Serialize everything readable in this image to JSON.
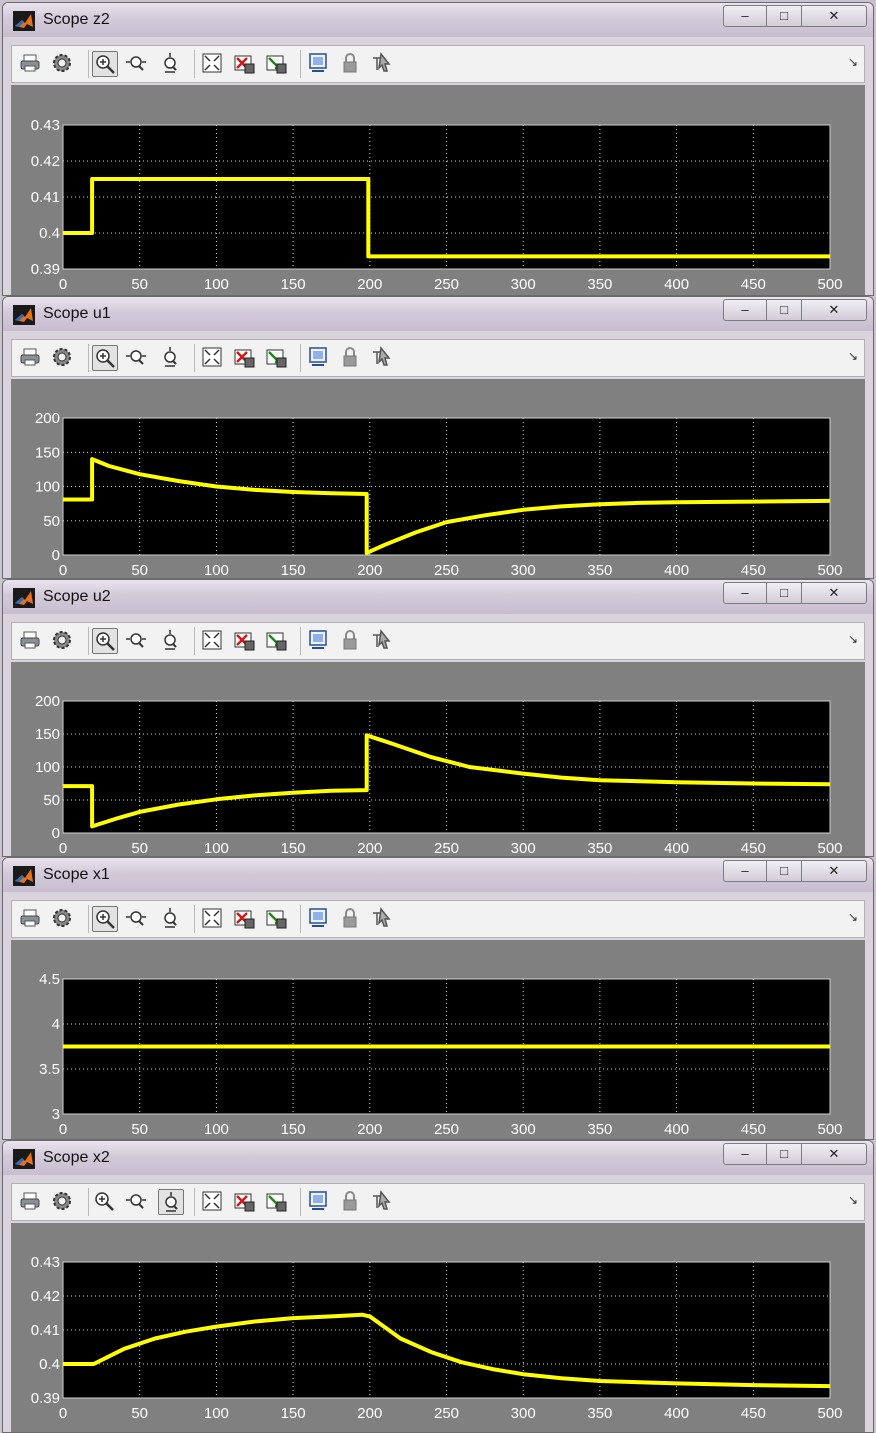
{
  "windows": [
    {
      "title": "Scope z2",
      "chart_data": {
        "type": "line",
        "xlim": [
          0,
          500
        ],
        "ylim": [
          0.39,
          0.43
        ],
        "xticks": [
          "0",
          "50",
          "100",
          "150",
          "200",
          "250",
          "300",
          "350",
          "400",
          "450",
          "500"
        ],
        "yticks": [
          "0.39",
          "0.4",
          "0.41",
          "0.42",
          "0.43"
        ],
        "grid": true,
        "color": "#ffff00",
        "x": [
          0,
          19,
          19,
          199,
          199,
          500
        ],
        "y": [
          0.4,
          0.4,
          0.415,
          0.415,
          0.3935,
          0.3935
        ]
      }
    },
    {
      "title": "Scope u1",
      "chart_data": {
        "type": "line",
        "xlim": [
          0,
          500
        ],
        "ylim": [
          0,
          200
        ],
        "xticks": [
          "0",
          "50",
          "100",
          "150",
          "200",
          "250",
          "300",
          "350",
          "400",
          "450",
          "500"
        ],
        "yticks": [
          "0",
          "50",
          "100",
          "150",
          "200"
        ],
        "grid": true,
        "color": "#ffff00",
        "x": [
          0,
          19,
          19,
          30,
          50,
          75,
          100,
          125,
          150,
          175,
          198,
          198,
          210,
          230,
          250,
          275,
          300,
          325,
          350,
          375,
          400,
          450,
          500
        ],
        "y": [
          81,
          81,
          140,
          130,
          118,
          108,
          100,
          95,
          92,
          90,
          89,
          3,
          15,
          33,
          48,
          58,
          66,
          71,
          74,
          76,
          77,
          78,
          79
        ]
      }
    },
    {
      "title": "Scope u2",
      "chart_data": {
        "type": "line",
        "xlim": [
          0,
          500
        ],
        "ylim": [
          0,
          200
        ],
        "xticks": [
          "0",
          "50",
          "100",
          "150",
          "200",
          "250",
          "300",
          "350",
          "400",
          "450",
          "500"
        ],
        "yticks": [
          "0",
          "50",
          "100",
          "150",
          "200"
        ],
        "grid": true,
        "color": "#ffff00",
        "x": [
          0,
          19,
          19,
          35,
          50,
          75,
          100,
          125,
          150,
          175,
          198,
          198,
          215,
          240,
          265,
          300,
          325,
          350,
          400,
          450,
          500
        ],
        "y": [
          71,
          71,
          10,
          22,
          32,
          43,
          51,
          57,
          61,
          64,
          65,
          148,
          135,
          115,
          100,
          90,
          84,
          80,
          77,
          75,
          74
        ]
      }
    },
    {
      "title": "Scope x1",
      "chart_data": {
        "type": "line",
        "xlim": [
          0,
          500
        ],
        "ylim": [
          3,
          4.5
        ],
        "xticks": [
          "0",
          "50",
          "100",
          "150",
          "200",
          "250",
          "300",
          "350",
          "400",
          "450",
          "500"
        ],
        "yticks": [
          "3",
          "3.5",
          "4",
          "4.5"
        ],
        "grid": true,
        "color": "#ffff00",
        "x": [
          0,
          500
        ],
        "y": [
          3.75,
          3.75
        ]
      }
    },
    {
      "title": "Scope x2",
      "chart_data": {
        "type": "line",
        "xlim": [
          0,
          500
        ],
        "ylim": [
          0.39,
          0.43
        ],
        "xticks": [
          "0",
          "50",
          "100",
          "150",
          "200",
          "250",
          "300",
          "350",
          "400",
          "450",
          "500"
        ],
        "yticks": [
          "0.39",
          "0.4",
          "0.41",
          "0.42",
          "0.43"
        ],
        "grid": true,
        "color": "#ffff00",
        "x": [
          0,
          20,
          40,
          60,
          80,
          100,
          125,
          150,
          175,
          195,
          200,
          220,
          240,
          260,
          280,
          300,
          325,
          350,
          400,
          450,
          500
        ],
        "y": [
          0.4,
          0.4,
          0.4045,
          0.4075,
          0.4095,
          0.411,
          0.4125,
          0.4135,
          0.414,
          0.4145,
          0.414,
          0.4075,
          0.4035,
          0.4005,
          0.3985,
          0.397,
          0.3958,
          0.395,
          0.3943,
          0.3938,
          0.3935
        ]
      }
    }
  ]
}
